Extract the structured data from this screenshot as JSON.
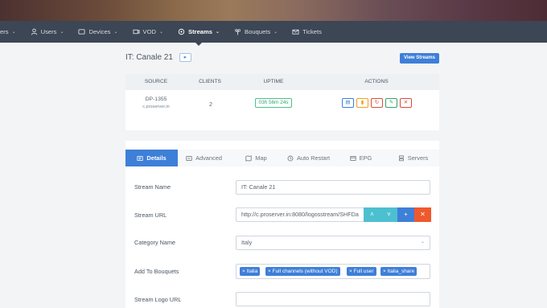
{
  "nav": {
    "items": [
      {
        "label": "ers",
        "icon": "chevron-down-icon",
        "has_chevron": true
      },
      {
        "label": "Users",
        "icon": "user-icon",
        "has_chevron": true
      },
      {
        "label": "Devices",
        "icon": "tv-icon",
        "has_chevron": true
      },
      {
        "label": "VOD",
        "icon": "film-icon",
        "has_chevron": true
      },
      {
        "label": "Streams",
        "icon": "signal-icon",
        "has_chevron": true,
        "active": true
      },
      {
        "label": "Bouquets",
        "icon": "flower-icon",
        "has_chevron": true
      },
      {
        "label": "Tickets",
        "icon": "envelope-icon",
        "has_chevron": false
      }
    ],
    "chevron": "⌄"
  },
  "page": {
    "title": "IT: Canale 21",
    "title_button_icon": "▸",
    "view_button": "View Streams"
  },
  "source_table": {
    "headers": [
      "SOURCE",
      "CLIENTS",
      "UPTIME",
      "ACTIONS"
    ],
    "row": {
      "source_name": "DP-1355",
      "source_host": "c.proserver.in",
      "clients": "2",
      "uptime": "03h 56m 24s"
    },
    "actions": [
      {
        "name": "info-action",
        "glyph": "▤",
        "color": "#3e7fd8"
      },
      {
        "name": "pause-action",
        "glyph": "▮",
        "color": "#f0a020"
      },
      {
        "name": "restart-action",
        "glyph": "↻",
        "color": "#e04a3a"
      },
      {
        "name": "edit-action",
        "glyph": "✎",
        "color": "#2ea66d"
      },
      {
        "name": "delete-action",
        "glyph": "✕",
        "color": "#e04a3a"
      }
    ]
  },
  "tabs": [
    {
      "label": "Details",
      "icon": "details-icon",
      "active": true
    },
    {
      "label": "Advanced",
      "icon": "advanced-icon"
    },
    {
      "label": "Map",
      "icon": "map-icon"
    },
    {
      "label": "Auto Restart",
      "icon": "clock-icon"
    },
    {
      "label": "EPG",
      "icon": "epg-icon"
    },
    {
      "label": "Servers",
      "icon": "servers-icon"
    }
  ],
  "form": {
    "stream_name_label": "Stream Name",
    "stream_name_value": "IT: Canale 21",
    "stream_url_label": "Stream URL",
    "stream_url_value": "http://c.proserver.in:8080/logosstream/SHFDa",
    "url_buttons": [
      {
        "name": "move-up-button",
        "glyph": "˄",
        "color": "#4cc0d0"
      },
      {
        "name": "move-down-button",
        "glyph": "˅",
        "color": "#4cc0d0"
      },
      {
        "name": "add-url-button",
        "glyph": "+",
        "color": "#3e7fd8"
      },
      {
        "name": "remove-url-button",
        "glyph": "✕",
        "color": "#f0582e"
      }
    ],
    "category_label": "Category Name",
    "category_value": "Italy",
    "bouquets_label": "Add To Bouquets",
    "bouquets": [
      "× Italia",
      "× Full channels (without VOD)",
      "× Full user",
      "× Italia_share"
    ],
    "logo_label": "Stream Logo URL",
    "logo_value": ""
  },
  "colors": {
    "accent": "#3e7fd8",
    "nav_bg": "#3c4654",
    "uptime": "#2ea66d"
  }
}
